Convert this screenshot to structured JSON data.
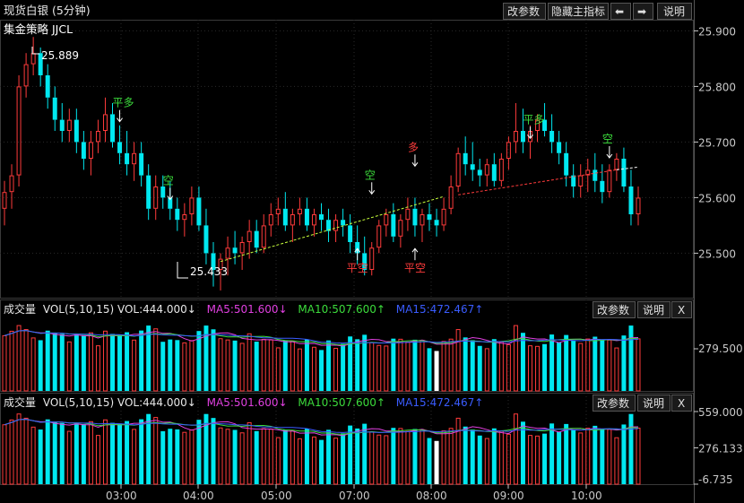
{
  "title": "现货白银 (5分钟)",
  "strategy_label": "集金策略 JJCL",
  "toolbar": {
    "params": "改参数",
    "hide_indicator": "隐藏主指标",
    "left": "⬅",
    "right": "➡",
    "help": "说明"
  },
  "colors": {
    "up": "#ff3b3b",
    "down": "#00e8f0",
    "ma5": "#e040e0",
    "ma10": "#3cdc3c",
    "ma15": "#3a5cff",
    "signal_green": "#3cdc3c",
    "signal_red": "#ff3b3b",
    "axis": "#c8c8c8",
    "grid": "#2a2a2a",
    "white": "#ffffff"
  },
  "price_panel": {
    "y_ticks": [
      "25.900",
      "25.800",
      "25.700",
      "25.600",
      "25.500"
    ],
    "high_label": "25.889",
    "low_label": "25.433"
  },
  "signals": [
    {
      "text": "平多",
      "color": "green",
      "arrow": "down"
    },
    {
      "text": "空",
      "color": "green",
      "arrow": "down"
    },
    {
      "text": "空",
      "color": "green",
      "arrow": "down"
    },
    {
      "text": "平空",
      "color": "red",
      "arrow": "up"
    },
    {
      "text": "多",
      "color": "red",
      "arrow": "down"
    },
    {
      "text": "平空",
      "color": "red",
      "arrow": "up"
    },
    {
      "text": "平多",
      "color": "green",
      "arrow": "down"
    },
    {
      "text": "空",
      "color": "green",
      "arrow": "down"
    }
  ],
  "vol_panel_1": {
    "header": {
      "name": "成交量",
      "vol": "VOL(5,10,15) VOL:444.000↓",
      "ma5": "MA5:501.600↓",
      "ma10": "MA10:507.600↑",
      "ma15": "MA15:472.467↑"
    },
    "buttons": {
      "params": "改参数",
      "help": "说明",
      "close": "X"
    },
    "y_tick": "279.500"
  },
  "vol_panel_2": {
    "header": {
      "name": "成交量",
      "vol": "VOL(5,10,15) VOL:444.000↓",
      "ma5": "MA5:501.600↓",
      "ma10": "MA10:507.600↑",
      "ma15": "MA15:472.467↑"
    },
    "buttons": {
      "params": "改参数",
      "help": "说明",
      "close": "X"
    },
    "y_ticks": [
      "559.000",
      "276.133",
      "-6.735"
    ]
  },
  "x_ticks": [
    "03:00",
    "04:00",
    "05:00",
    "07:00",
    "08:00",
    "09:00",
    "10:00"
  ],
  "chart_data": [
    {
      "type": "candlestick",
      "series": "现货白银 5分钟",
      "y_range": [
        25.42,
        25.92
      ],
      "ticks": [
        25.9,
        25.8,
        25.7,
        25.6,
        25.5
      ],
      "ohlc_note": "open,high,low,close per 5-minute bar (estimated)",
      "candles": [
        [
          25.58,
          25.63,
          25.55,
          25.61
        ],
        [
          25.61,
          25.66,
          25.58,
          25.64
        ],
        [
          25.64,
          25.82,
          25.62,
          25.8
        ],
        [
          25.8,
          25.86,
          25.78,
          25.84
        ],
        [
          25.84,
          25.889,
          25.82,
          25.86
        ],
        [
          25.86,
          25.87,
          25.8,
          25.82
        ],
        [
          25.82,
          25.84,
          25.76,
          25.78
        ],
        [
          25.78,
          25.8,
          25.72,
          25.74
        ],
        [
          25.74,
          25.77,
          25.7,
          25.72
        ],
        [
          25.72,
          25.76,
          25.7,
          25.74
        ],
        [
          25.74,
          25.76,
          25.68,
          25.7
        ],
        [
          25.7,
          25.72,
          25.65,
          25.67
        ],
        [
          25.67,
          25.72,
          25.64,
          25.7
        ],
        [
          25.7,
          25.74,
          25.68,
          25.72
        ],
        [
          25.72,
          25.78,
          25.7,
          25.75
        ],
        [
          25.75,
          25.77,
          25.69,
          25.7
        ],
        [
          25.7,
          25.73,
          25.66,
          25.68
        ],
        [
          25.68,
          25.72,
          25.64,
          25.66
        ],
        [
          25.66,
          25.7,
          25.63,
          25.68
        ],
        [
          25.68,
          25.7,
          25.62,
          25.64
        ],
        [
          25.64,
          25.66,
          25.56,
          25.58
        ],
        [
          25.58,
          25.64,
          25.56,
          25.62
        ],
        [
          25.62,
          25.64,
          25.58,
          25.6
        ],
        [
          25.6,
          25.63,
          25.56,
          25.58
        ],
        [
          25.58,
          25.6,
          25.54,
          25.56
        ],
        [
          25.56,
          25.59,
          25.53,
          25.57
        ],
        [
          25.57,
          25.62,
          25.55,
          25.6
        ],
        [
          25.6,
          25.62,
          25.54,
          25.55
        ],
        [
          25.55,
          25.58,
          25.48,
          25.5
        ],
        [
          25.5,
          25.52,
          25.44,
          25.47
        ],
        [
          25.47,
          25.5,
          25.433,
          25.49
        ],
        [
          25.49,
          25.53,
          25.46,
          25.51
        ],
        [
          25.51,
          25.54,
          25.48,
          25.5
        ],
        [
          25.5,
          25.53,
          25.47,
          25.52
        ],
        [
          25.52,
          25.56,
          25.49,
          25.54
        ],
        [
          25.54,
          25.56,
          25.5,
          25.51
        ],
        [
          25.51,
          25.57,
          25.5,
          25.55
        ],
        [
          25.55,
          25.59,
          25.53,
          25.57
        ],
        [
          25.57,
          25.6,
          25.55,
          25.58
        ],
        [
          25.58,
          25.61,
          25.54,
          25.55
        ],
        [
          25.55,
          25.58,
          25.52,
          25.57
        ],
        [
          25.57,
          25.6,
          25.55,
          25.58
        ],
        [
          25.58,
          25.6,
          25.54,
          25.55
        ],
        [
          25.55,
          25.58,
          25.53,
          25.57
        ],
        [
          25.57,
          25.59,
          25.54,
          25.56
        ],
        [
          25.56,
          25.58,
          25.52,
          25.54
        ],
        [
          25.54,
          25.57,
          25.52,
          25.56
        ],
        [
          25.56,
          25.58,
          25.53,
          25.55
        ],
        [
          25.55,
          25.57,
          25.5,
          25.52
        ],
        [
          25.52,
          25.55,
          25.48,
          25.5
        ],
        [
          25.5,
          25.53,
          25.46,
          25.47
        ],
        [
          25.47,
          25.52,
          25.46,
          25.51
        ],
        [
          25.51,
          25.56,
          25.5,
          25.55
        ],
        [
          25.55,
          25.58,
          25.53,
          25.57
        ],
        [
          25.57,
          25.59,
          25.52,
          25.53
        ],
        [
          25.53,
          25.57,
          25.51,
          25.56
        ],
        [
          25.56,
          25.6,
          25.54,
          25.58
        ],
        [
          25.58,
          25.6,
          25.53,
          25.55
        ],
        [
          25.55,
          25.58,
          25.52,
          25.57
        ],
        [
          25.57,
          25.59,
          25.54,
          25.56
        ],
        [
          25.56,
          25.58,
          25.53,
          25.55
        ],
        [
          25.55,
          25.6,
          25.54,
          25.58
        ],
        [
          25.58,
          25.64,
          25.57,
          25.62
        ],
        [
          25.62,
          25.69,
          25.61,
          25.68
        ],
        [
          25.68,
          25.71,
          25.64,
          25.66
        ],
        [
          25.66,
          25.7,
          25.63,
          25.65
        ],
        [
          25.65,
          25.67,
          25.62,
          25.64
        ],
        [
          25.64,
          25.67,
          25.62,
          25.66
        ],
        [
          25.66,
          25.68,
          25.62,
          25.63
        ],
        [
          25.63,
          25.68,
          25.62,
          25.67
        ],
        [
          25.67,
          25.71,
          25.65,
          25.7
        ],
        [
          25.7,
          25.77,
          25.68,
          25.72
        ],
        [
          25.72,
          25.76,
          25.68,
          25.7
        ],
        [
          25.7,
          25.73,
          25.67,
          25.72
        ],
        [
          25.72,
          25.75,
          25.7,
          25.74
        ],
        [
          25.74,
          25.77,
          25.71,
          25.72
        ],
        [
          25.72,
          25.75,
          25.68,
          25.7
        ],
        [
          25.7,
          25.72,
          25.66,
          25.68
        ],
        [
          25.68,
          25.7,
          25.62,
          25.64
        ],
        [
          25.64,
          25.66,
          25.6,
          25.62
        ],
        [
          25.62,
          25.66,
          25.6,
          25.64
        ],
        [
          25.64,
          25.67,
          25.61,
          25.65
        ],
        [
          25.65,
          25.68,
          25.61,
          25.63
        ],
        [
          25.63,
          25.66,
          25.59,
          25.61
        ],
        [
          25.61,
          25.66,
          25.6,
          25.65
        ],
        [
          25.65,
          25.68,
          25.63,
          25.67
        ],
        [
          25.67,
          25.69,
          25.61,
          25.62
        ],
        [
          25.62,
          25.65,
          25.55,
          25.57
        ],
        [
          25.57,
          25.62,
          25.55,
          25.6
        ]
      ]
    },
    {
      "type": "bar",
      "series": "VOL(5,10,15)",
      "current": {
        "VOL": 444.0,
        "MA5": 501.6,
        "MA10": 507.6,
        "MA15": 472.467
      },
      "y_range": [
        -6.735,
        559.0
      ],
      "ticks": [
        559.0,
        276.133,
        -6.735
      ]
    }
  ]
}
